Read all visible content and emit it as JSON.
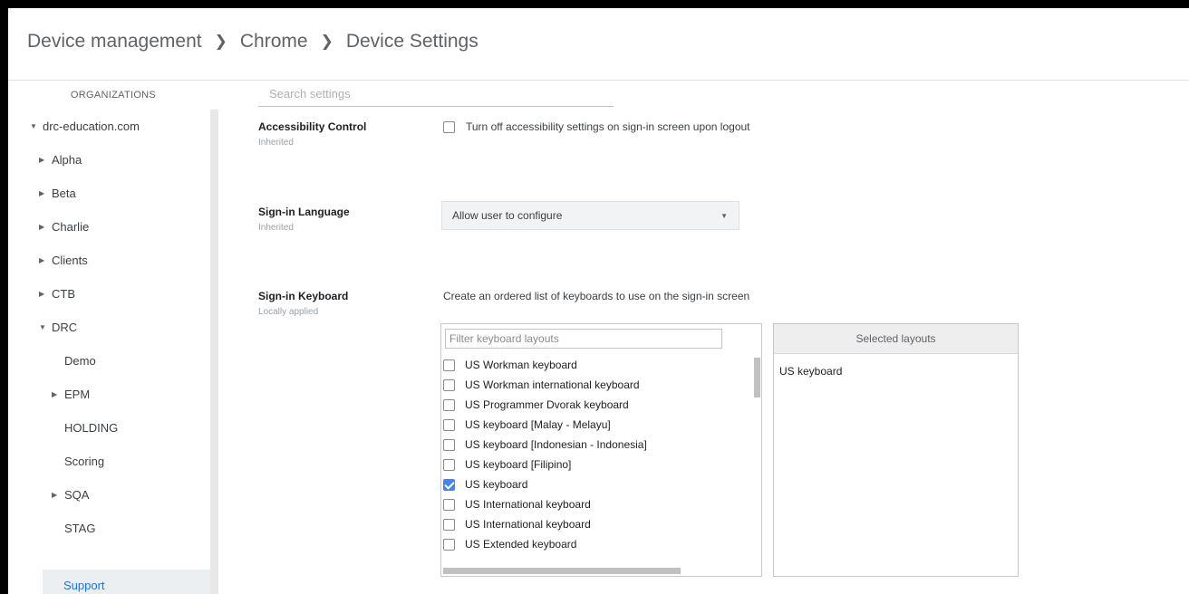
{
  "breadcrumb": [
    "Device management",
    "Chrome",
    "Device Settings"
  ],
  "sidebar": {
    "heading": "ORGANIZATIONS",
    "items": [
      {
        "label": "drc-education.com",
        "arrow": "▼",
        "level": 0
      },
      {
        "label": "Alpha",
        "arrow": "▶",
        "level": 1
      },
      {
        "label": "Beta",
        "arrow": "▶",
        "level": 1
      },
      {
        "label": "Charlie",
        "arrow": "▶",
        "level": 1
      },
      {
        "label": "Clients",
        "arrow": "▶",
        "level": 1
      },
      {
        "label": "CTB",
        "arrow": "▶",
        "level": 1
      },
      {
        "label": "DRC",
        "arrow": "▼",
        "level": 1
      },
      {
        "label": "Demo",
        "arrow": "",
        "level": 2
      },
      {
        "label": "EPM",
        "arrow": "▶",
        "level": 2
      },
      {
        "label": "HOLDING",
        "arrow": "",
        "level": 2
      },
      {
        "label": "Scoring",
        "arrow": "",
        "level": 2
      },
      {
        "label": "SQA",
        "arrow": "▶",
        "level": 2
      },
      {
        "label": "STAG",
        "arrow": "",
        "level": 2
      },
      {
        "label": "Support",
        "arrow": "",
        "level": 2,
        "active": true
      }
    ]
  },
  "search": {
    "placeholder": "Search settings"
  },
  "settings": {
    "accessibility": {
      "title": "Accessibility Control",
      "status": "Inherited",
      "checkbox_label": "Turn off accessibility settings on sign-in screen upon logout"
    },
    "language": {
      "title": "Sign-in Language",
      "status": "Inherited",
      "selected": "Allow user to configure"
    },
    "keyboard": {
      "title": "Sign-in Keyboard",
      "status": "Locally applied",
      "description": "Create an ordered list of keyboards to use on the sign-in screen",
      "filter_placeholder": "Filter keyboard layouts",
      "layouts": [
        {
          "label": "US Workman keyboard",
          "checked": false
        },
        {
          "label": "US Workman international keyboard",
          "checked": false
        },
        {
          "label": "US Programmer Dvorak keyboard",
          "checked": false
        },
        {
          "label": "US keyboard [Malay - Melayu]",
          "checked": false
        },
        {
          "label": "US keyboard [Indonesian - Indonesia]",
          "checked": false
        },
        {
          "label": "US keyboard [Filipino]",
          "checked": false
        },
        {
          "label": "US keyboard",
          "checked": true
        },
        {
          "label": "US International keyboard",
          "checked": false
        },
        {
          "label": "US International keyboard",
          "checked": false
        },
        {
          "label": "US Extended keyboard",
          "checked": false
        }
      ],
      "selected_heading": "Selected layouts",
      "selected_layouts": [
        "US keyboard"
      ]
    }
  },
  "colors": {
    "accent": "#1a73e8",
    "checkbox_checked": "#4285f4"
  }
}
